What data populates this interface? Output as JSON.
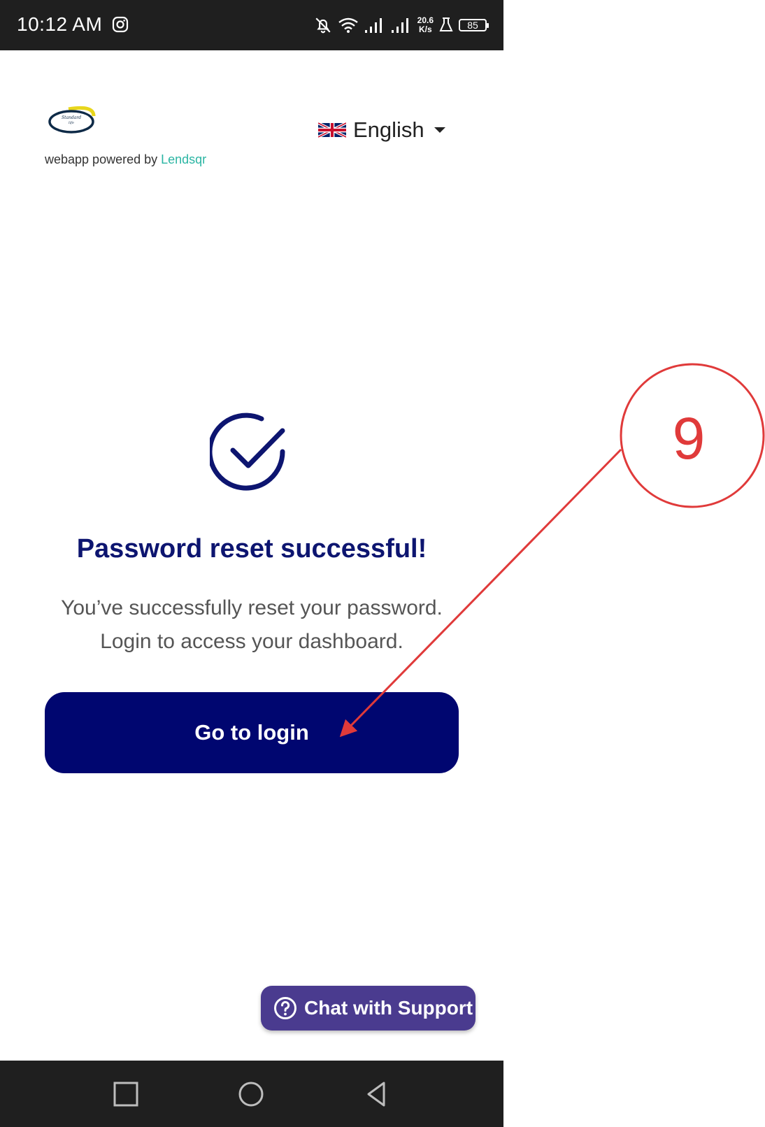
{
  "status_bar": {
    "time": "10:12 AM",
    "net_speed_value": "20.6",
    "net_speed_unit": "K/s",
    "battery": "85",
    "icons": [
      "instagram-icon",
      "bell-off-icon",
      "wifi-icon",
      "signal-icon",
      "signal-icon",
      "flask-icon",
      "battery-icon"
    ]
  },
  "header": {
    "logo_text": "Standard life",
    "powered_prefix": "webapp powered by ",
    "powered_brand": "Lendsqr",
    "language": "English"
  },
  "content": {
    "title": "Password reset successful!",
    "description_line1": "You’ve successfully reset your password.",
    "description_line2": "Login to access your dashboard.",
    "button_label": "Go to login"
  },
  "chat": {
    "label": "Chat with Support"
  },
  "annotation": {
    "number": "9"
  },
  "colors": {
    "primary": "#000670",
    "title": "#0d1570",
    "brand_link": "#2bb5a3",
    "chat_bg": "#4a3b8f",
    "annotation": "#e03a3a",
    "system_bar": "#1f1f1f"
  }
}
